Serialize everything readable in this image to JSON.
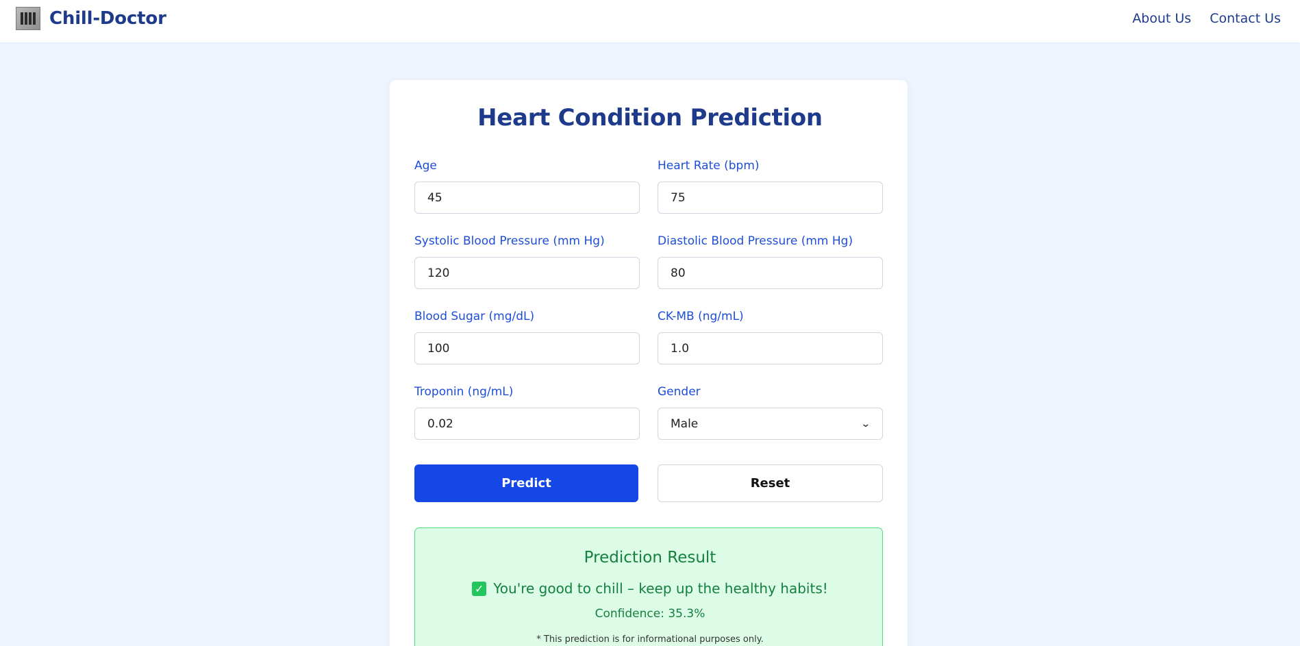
{
  "nav": {
    "brand": "Chill-Doctor",
    "links": [
      "About Us",
      "Contact Us"
    ]
  },
  "form": {
    "title": "Heart Condition Prediction",
    "fields": [
      {
        "label": "Age",
        "value": "45"
      },
      {
        "label": "Heart Rate (bpm)",
        "value": "75"
      },
      {
        "label": "Systolic Blood Pressure (mm Hg)",
        "value": "120"
      },
      {
        "label": "Diastolic Blood Pressure (mm Hg)",
        "value": "80"
      },
      {
        "label": "Blood Sugar (mg/dL)",
        "value": "100"
      },
      {
        "label": "CK-MB (ng/mL)",
        "value": "1.0"
      },
      {
        "label": "Troponin (ng/mL)",
        "value": "0.02"
      },
      {
        "label": "Gender",
        "value": "Male"
      }
    ],
    "predict_label": "Predict",
    "reset_label": "Reset"
  },
  "result": {
    "title": "Prediction Result",
    "icon": "check-box-icon",
    "message": "You're good to chill – keep up the healthy habits!",
    "confidence": "Confidence: 35.3%",
    "disclaimer": "* This prediction is for informational purposes only."
  },
  "colors": {
    "primary": "#1447e6",
    "brand_text": "#1e3a8a",
    "label_text": "#1d4ed8",
    "page_bg": "#eef5fe",
    "result_bg": "#dcfce7",
    "result_text": "#15803d"
  }
}
